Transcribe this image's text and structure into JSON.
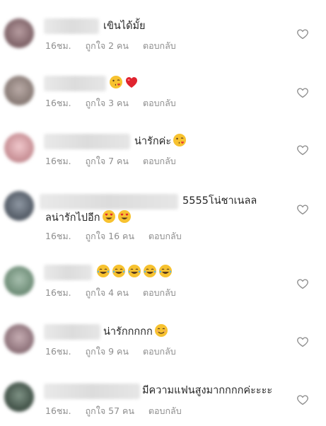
{
  "comments": [
    {
      "text": "เขินได้มั้ย",
      "time": "16ชม.",
      "likes": "ถูกใจ 2 คน",
      "reply": "ตอบกลับ",
      "emojis": [],
      "avatar_color": "#8a6e72"
    },
    {
      "text": "",
      "time": "16ชม.",
      "likes": "ถูกใจ 3 คน",
      "reply": "ตอบกลับ",
      "emojis": [
        "kissing-face-emoji",
        "red-heart-emoji"
      ],
      "avatar_color": "#9a8c88"
    },
    {
      "text": "น่ารักค่ะ",
      "time": "16ชม.",
      "likes": "ถูกใจ 7 คน",
      "reply": "ตอบกลับ",
      "emojis": [
        "kissing-face-emoji"
      ],
      "avatar_color": "#d3a4a8"
    },
    {
      "text": "5555โน่ชาเนลล",
      "text_line2": "ลน่ารักไปอีก",
      "time": "16ชม.",
      "likes": "ถูกใจ 16 คน",
      "reply": "ตอบกลับ",
      "emojis": [
        "heart-eyes-emoji",
        "heart-eyes-emoji"
      ],
      "avatar_color": "#5d6570"
    },
    {
      "text": "",
      "time": "16ชม.",
      "likes": "ถูกใจ 4 คน",
      "reply": "ตอบกลับ",
      "emojis": [
        "tears-of-joy-emoji",
        "tears-of-joy-emoji",
        "tears-of-joy-emoji",
        "tears-of-joy-emoji",
        "tears-of-joy-emoji"
      ],
      "avatar_color": "#7f9a86"
    },
    {
      "text": "น่ารักกกกก",
      "time": "16ชม.",
      "likes": "ถูกใจ 9 คน",
      "reply": "ตอบกลับ",
      "emojis": [
        "smiling-face-emoji"
      ],
      "avatar_color": "#9b7f86"
    },
    {
      "text": "มีความแฟนสูงมากกกกค่ะะะะ",
      "time": "16ชม.",
      "likes": "ถูกใจ 57 คน",
      "reply": "ตอบกลับ",
      "emojis": [],
      "avatar_color": "#4c5e55"
    }
  ],
  "colors": {
    "text": "#262626",
    "meta": "#8e8e8e",
    "heart_outline": "#8e8e8e"
  }
}
